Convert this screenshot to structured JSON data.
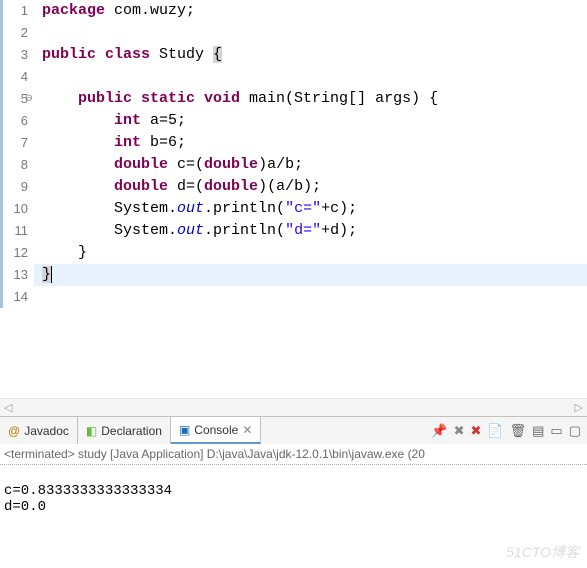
{
  "editor": {
    "lines": [
      {
        "n": 1,
        "tokens": [
          {
            "t": "package ",
            "c": "kw"
          },
          {
            "t": "com.wuzy;",
            "c": "norm"
          }
        ]
      },
      {
        "n": 2,
        "tokens": []
      },
      {
        "n": 3,
        "tokens": [
          {
            "t": "public class ",
            "c": "kw"
          },
          {
            "t": "Study ",
            "c": "cls"
          },
          {
            "t": "{",
            "c": "paren-hl"
          }
        ]
      },
      {
        "n": 4,
        "tokens": []
      },
      {
        "n": 5,
        "ann": "⊖",
        "tokens": [
          {
            "t": "    ",
            "c": "norm"
          },
          {
            "t": "public static void ",
            "c": "kw"
          },
          {
            "t": "main(String[] args) {",
            "c": "norm"
          }
        ]
      },
      {
        "n": 6,
        "tokens": [
          {
            "t": "        ",
            "c": "norm"
          },
          {
            "t": "int ",
            "c": "kw"
          },
          {
            "t": "a=5;",
            "c": "norm"
          }
        ]
      },
      {
        "n": 7,
        "tokens": [
          {
            "t": "        ",
            "c": "norm"
          },
          {
            "t": "int ",
            "c": "kw"
          },
          {
            "t": "b=6;",
            "c": "norm"
          }
        ]
      },
      {
        "n": 8,
        "tokens": [
          {
            "t": "        ",
            "c": "norm"
          },
          {
            "t": "double ",
            "c": "kw"
          },
          {
            "t": "c=(",
            "c": "norm"
          },
          {
            "t": "double",
            "c": "kw"
          },
          {
            "t": ")a/b;",
            "c": "norm"
          }
        ]
      },
      {
        "n": 9,
        "tokens": [
          {
            "t": "        ",
            "c": "norm"
          },
          {
            "t": "double ",
            "c": "kw"
          },
          {
            "t": "d=(",
            "c": "norm"
          },
          {
            "t": "double",
            "c": "kw"
          },
          {
            "t": ")(a/b);",
            "c": "norm"
          }
        ]
      },
      {
        "n": 10,
        "tokens": [
          {
            "t": "        System.",
            "c": "norm"
          },
          {
            "t": "out",
            "c": "sf"
          },
          {
            "t": ".println(",
            "c": "norm"
          },
          {
            "t": "\"c=\"",
            "c": "str"
          },
          {
            "t": "+c);",
            "c": "norm"
          }
        ]
      },
      {
        "n": 11,
        "tokens": [
          {
            "t": "        System.",
            "c": "norm"
          },
          {
            "t": "out",
            "c": "sf"
          },
          {
            "t": ".println(",
            "c": "norm"
          },
          {
            "t": "\"d=\"",
            "c": "str"
          },
          {
            "t": "+d);",
            "c": "norm"
          }
        ]
      },
      {
        "n": 12,
        "tokens": [
          {
            "t": "    }",
            "c": "norm"
          }
        ]
      },
      {
        "n": 13,
        "hl": true,
        "tokens": [
          {
            "t": "}",
            "c": "paren-hl"
          },
          {
            "t": "",
            "c": "cursor"
          }
        ]
      },
      {
        "n": 14,
        "tokens": []
      }
    ]
  },
  "tabs": {
    "javadoc": "Javadoc",
    "declaration": "Declaration",
    "console": "Console"
  },
  "toolbar": {
    "pin": "📌",
    "remove_all": "✖",
    "remove": "✖",
    "scroll_lock": "📄",
    "clear": "🗑",
    "toggle": "▤",
    "min": "▭",
    "max": "▢"
  },
  "console": {
    "header": "<terminated> study [Java Application] D:\\java\\Java\\jdk-12.0.1\\bin\\javaw.exe  (20",
    "out1": "c=0.8333333333333334",
    "out2": "d=0.0"
  },
  "watermark": "51CTO博客"
}
